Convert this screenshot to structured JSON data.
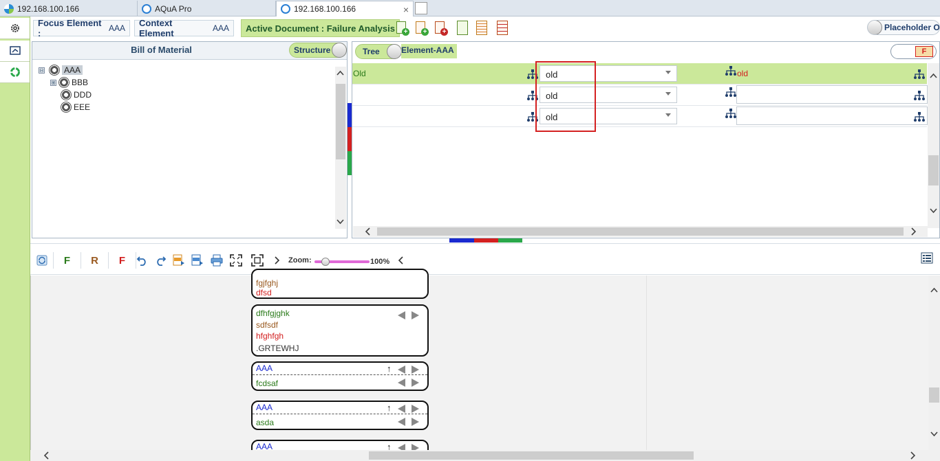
{
  "browser": {
    "tabs": [
      {
        "label": "192.168.100.166"
      },
      {
        "label": "AQuA Pro"
      },
      {
        "label": "192.168.100.166"
      }
    ],
    "close_glyph": "×"
  },
  "toolbar": {
    "focus_label": "Focus Element :",
    "focus_value": "AAA",
    "context_label": "Context Element",
    "context_value": "AAA",
    "active_doc": "Active Document : Failure Analysis",
    "placeholder_toggle": "Placeholder Off"
  },
  "bom": {
    "title": "Bill of Material",
    "structure_toggle": "Structure",
    "items": [
      {
        "label": "AAA",
        "expander": "⊟"
      },
      {
        "label": "BBB",
        "expander": "⊞"
      },
      {
        "label": "DDD"
      },
      {
        "label": "EEE"
      }
    ]
  },
  "tree": {
    "toggle_label": "Tree",
    "element_label": "Element-AAA",
    "f_badge": "F",
    "rows": [
      {
        "left_text": "Old",
        "combo": "old",
        "right_text": "old"
      },
      {
        "left_text": "",
        "combo": "old",
        "right_text": ""
      },
      {
        "left_text": "",
        "combo": "old",
        "right_text": ""
      }
    ]
  },
  "diagram_toolbar": {
    "f1": "F",
    "r": "R",
    "f2": "F",
    "zoom_label": "Zoom:",
    "zoom_value": "100%",
    "zoom_level": 1.0
  },
  "nodes": [
    {
      "lines": [
        "fgjfghj",
        "dfsd"
      ]
    },
    {
      "lines": [
        "dfhfgjghk",
        "sdfsdf",
        "hfghfgh",
        ".GRTEWHJ"
      ]
    },
    {
      "head": "AAA",
      "body": "fcdsaf",
      "up": "↑"
    },
    {
      "head": "AAA",
      "body": "asda",
      "up": "↑"
    },
    {
      "head": "AAA",
      "up": "↑"
    }
  ],
  "colors": {
    "accent_green": "#cbe89a",
    "nav_blue": "#1f3d6b",
    "highlight_red": "#d42020"
  }
}
